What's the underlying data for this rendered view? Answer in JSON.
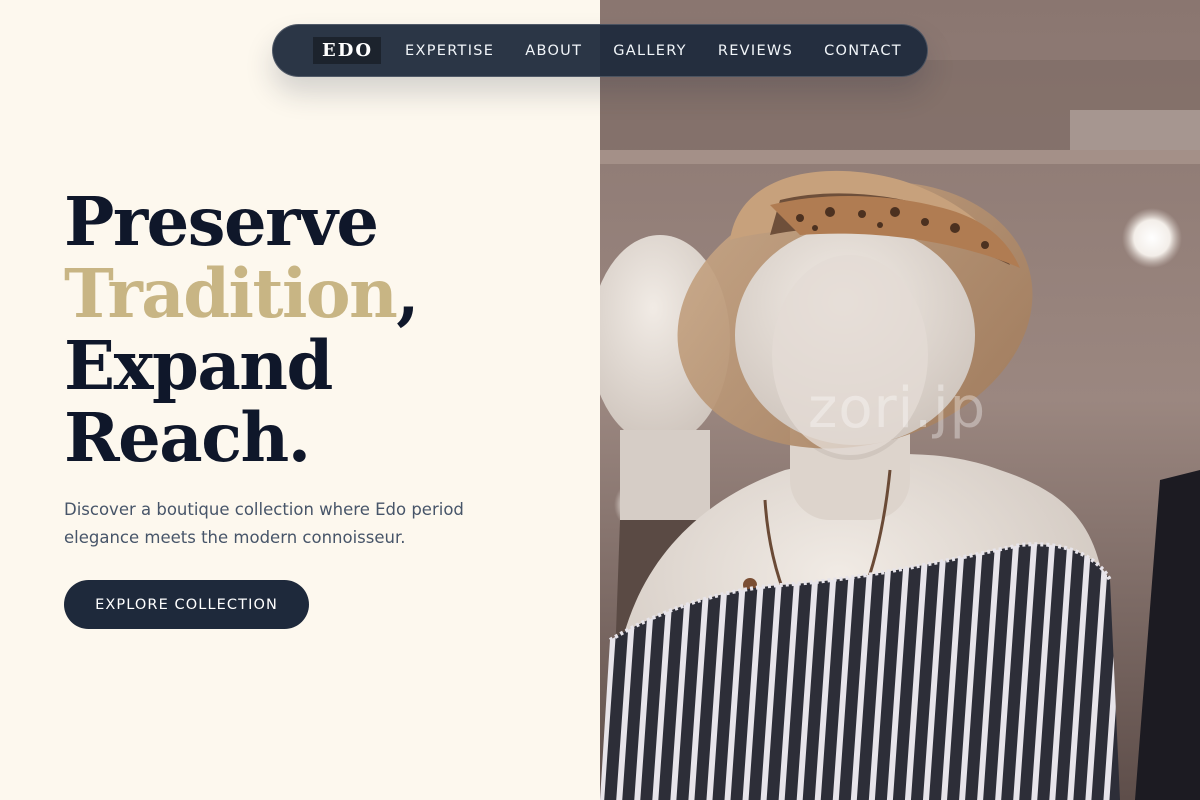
{
  "nav": {
    "logo": "EDO",
    "items": [
      {
        "label": "EXPERTISE"
      },
      {
        "label": "ABOUT"
      },
      {
        "label": "GALLERY"
      },
      {
        "label": "REVIEWS"
      },
      {
        "label": "CONTACT"
      }
    ]
  },
  "hero": {
    "line1": "Preserve",
    "line2_accent": "Tradition",
    "line2_punct": ",",
    "line3": "Expand",
    "line4": "Reach.",
    "subtitle": "Discover a boutique collection where Edo period elegance meets the modern connoisseur.",
    "cta_label": "EXPLORE COLLECTION"
  },
  "image": {
    "watermark": "zori.jp",
    "alt_subject": "mannequin-with-straw-hat"
  },
  "colors": {
    "background": "#fdf8ee",
    "navy": "#1e293b",
    "headline": "#0f172a",
    "accent_gold": "#c8b584",
    "body_text": "#475569"
  }
}
